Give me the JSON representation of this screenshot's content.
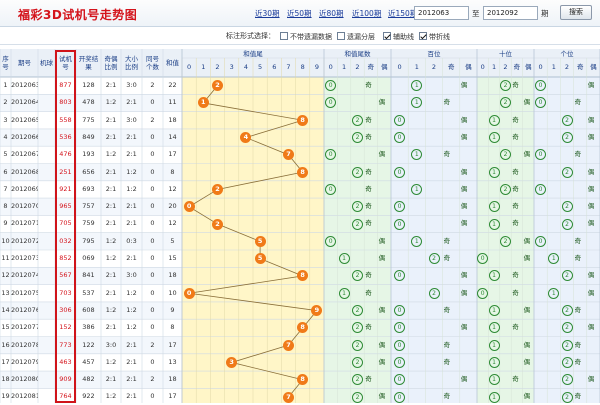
{
  "header": {
    "title": "福彩3D试机号走势图",
    "links": [
      "近30期",
      "近50期",
      "近80期",
      "近100期",
      "近150期"
    ],
    "start_date": "2012063",
    "to_label": "至",
    "end_date": "2012092",
    "period_label": "期",
    "search_label": "搜索"
  },
  "options": {
    "label": "标注形式选择：",
    "items": [
      {
        "label": "不带遗漏数据",
        "checked": false
      },
      {
        "label": "遗漏分层",
        "checked": false
      },
      {
        "label": "辅助线",
        "checked": true
      },
      {
        "label": "带折线",
        "checked": true
      }
    ]
  },
  "table": {
    "headers": [
      "序号",
      "期号",
      "机球",
      "试机号",
      "开奖结果",
      "奇偶比例",
      "大小比例",
      "同号个数",
      "和值"
    ],
    "group_headers": [
      "和值尾",
      "和值尾数",
      "百位",
      "十位",
      "个位"
    ],
    "digits": [
      "0",
      "1",
      "2",
      "3",
      "4",
      "5",
      "6",
      "7",
      "8",
      "9"
    ],
    "sub_headers": [
      "0",
      "1",
      "2",
      "奇",
      "偶"
    ],
    "rows": [
      {
        "idx": "1",
        "period": "2012063",
        "ball": "",
        "trial": "877",
        "result": "128",
        "oe": "2:1",
        "bs": "3:0",
        "same": "2",
        "sum": "22",
        "tail": 2
      },
      {
        "idx": "2",
        "period": "2012064",
        "ball": "",
        "trial": "803",
        "result": "478",
        "oe": "1:2",
        "bs": "2:1",
        "same": "0",
        "sum": "11",
        "tail": 1
      },
      {
        "idx": "3",
        "period": "2012065",
        "ball": "",
        "trial": "558",
        "result": "775",
        "oe": "2:1",
        "bs": "3:0",
        "same": "2",
        "sum": "18",
        "tail": 8
      },
      {
        "idx": "4",
        "period": "2012066",
        "ball": "",
        "trial": "536",
        "result": "849",
        "oe": "2:1",
        "bs": "2:1",
        "same": "0",
        "sum": "14",
        "tail": 4
      },
      {
        "idx": "5",
        "period": "2012067",
        "ball": "",
        "trial": "476",
        "result": "193",
        "oe": "1:2",
        "bs": "2:1",
        "same": "0",
        "sum": "17",
        "tail": 7
      },
      {
        "idx": "6",
        "period": "2012068",
        "ball": "",
        "trial": "251",
        "result": "656",
        "oe": "2:1",
        "bs": "1:2",
        "same": "0",
        "sum": "8",
        "tail": 8
      },
      {
        "idx": "7",
        "period": "2012069",
        "ball": "",
        "trial": "921",
        "result": "693",
        "oe": "2:1",
        "bs": "1:2",
        "same": "0",
        "sum": "12",
        "tail": 2
      },
      {
        "idx": "8",
        "period": "2012070",
        "ball": "",
        "trial": "965",
        "result": "757",
        "oe": "2:1",
        "bs": "2:1",
        "same": "0",
        "sum": "20",
        "tail": 0
      },
      {
        "idx": "9",
        "period": "2012071",
        "ball": "",
        "trial": "705",
        "result": "759",
        "oe": "2:1",
        "bs": "2:1",
        "same": "0",
        "sum": "12",
        "tail": 2
      },
      {
        "idx": "10",
        "period": "2012072",
        "ball": "",
        "trial": "032",
        "result": "795",
        "oe": "1:2",
        "bs": "0:3",
        "same": "0",
        "sum": "5",
        "tail": 5
      },
      {
        "idx": "11",
        "period": "2012073",
        "ball": "",
        "trial": "852",
        "result": "069",
        "oe": "1:2",
        "bs": "2:1",
        "same": "0",
        "sum": "15",
        "tail": 5
      },
      {
        "idx": "12",
        "period": "2012074",
        "ball": "",
        "trial": "567",
        "result": "841",
        "oe": "2:1",
        "bs": "3:0",
        "same": "0",
        "sum": "18",
        "tail": 8
      },
      {
        "idx": "13",
        "period": "2012075",
        "ball": "",
        "trial": "703",
        "result": "537",
        "oe": "2:1",
        "bs": "1:2",
        "same": "0",
        "sum": "10",
        "tail": 0
      },
      {
        "idx": "14",
        "period": "2012076",
        "ball": "",
        "trial": "306",
        "result": "608",
        "oe": "1:2",
        "bs": "1:2",
        "same": "0",
        "sum": "9",
        "tail": 9
      },
      {
        "idx": "15",
        "period": "2012077",
        "ball": "",
        "trial": "152",
        "result": "386",
        "oe": "2:1",
        "bs": "1:2",
        "same": "0",
        "sum": "8",
        "tail": 8
      },
      {
        "idx": "16",
        "period": "2012078",
        "ball": "",
        "trial": "773",
        "result": "122",
        "oe": "3:0",
        "bs": "2:1",
        "same": "2",
        "sum": "17",
        "tail": 7
      },
      {
        "idx": "17",
        "period": "2012079",
        "ball": "",
        "trial": "463",
        "result": "457",
        "oe": "1:2",
        "bs": "2:1",
        "same": "0",
        "sum": "13",
        "tail": 3
      },
      {
        "idx": "18",
        "period": "2012080",
        "ball": "",
        "trial": "909",
        "result": "482",
        "oe": "2:1",
        "bs": "2:1",
        "same": "2",
        "sum": "18",
        "tail": 8
      },
      {
        "idx": "19",
        "period": "2012081",
        "ball": "",
        "trial": "764",
        "result": "922",
        "oe": "1:2",
        "bs": "2:1",
        "same": "0",
        "sum": "17",
        "tail": 7
      }
    ]
  },
  "colors": {
    "accent_red": "#d4141c",
    "ball_orange": "#f07a18",
    "yellow_band": "#fff6c8",
    "green_band": "#e6f6e6",
    "blue_band": "#eaf1fb"
  }
}
